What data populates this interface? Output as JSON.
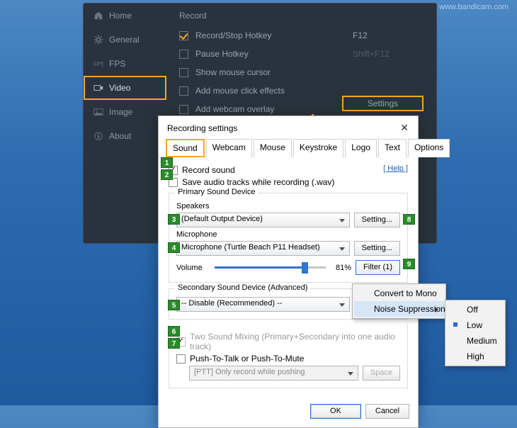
{
  "watermark": "www.bandicam.com",
  "main": {
    "sidebar": [
      {
        "label": "Home",
        "icon": "home-icon"
      },
      {
        "label": "General",
        "icon": "gear-icon"
      },
      {
        "label": "FPS",
        "icon": "fps-icon"
      },
      {
        "label": "Video",
        "icon": "video-icon"
      },
      {
        "label": "Image",
        "icon": "image-icon"
      },
      {
        "label": "About",
        "icon": "info-icon"
      }
    ],
    "section_title": "Record",
    "options": [
      {
        "label": "Record/Stop Hotkey",
        "hotkey": "F12",
        "checked": true
      },
      {
        "label": "Pause Hotkey",
        "hotkey": "Shift+F12",
        "checked": false
      },
      {
        "label": "Show mouse cursor",
        "hotkey": "",
        "checked": false
      },
      {
        "label": "Add mouse click effects",
        "hotkey": "",
        "checked": false
      },
      {
        "label": "Add webcam overlay",
        "hotkey": "",
        "checked": false
      }
    ],
    "settings_btn": "Settings"
  },
  "dialog": {
    "title": "Recording settings",
    "tabs": [
      "Sound",
      "Webcam",
      "Mouse",
      "Keystroke",
      "Logo",
      "Text",
      "Options"
    ],
    "help_label": "[ Help ]",
    "record_sound": "Record sound",
    "save_wav": "Save audio tracks while recording (.wav)",
    "primary_title": "Primary Sound Device",
    "speakers_label": "Speakers",
    "speakers_value": "(Default Output Device)",
    "setting_btn": "Setting...",
    "mic_label": "Microphone",
    "mic_value": "Microphone (Turtle Beach P11 Headset)",
    "volume_label": "Volume",
    "volume_pct": "81%",
    "volume_value": 81,
    "filter_btn": "Filter (1)",
    "secondary_title": "Secondary Sound Device (Advanced)",
    "secondary_value": "-- Disable (Recommended) --",
    "mixing": "Two Sound Mixing (Primary+Secondary into one audio track)",
    "ptt": "Push-To-Talk or Push-To-Mute",
    "ptt_mode": "[PTT] Only record while pushing",
    "ptt_key": "Space",
    "ok": "OK",
    "cancel": "Cancel"
  },
  "filter_menu": [
    "Convert to Mono",
    "Noise Suppression"
  ],
  "noise_menu": [
    "Off",
    "Low",
    "Medium",
    "High"
  ],
  "noise_selected": "Low",
  "badges": {
    "1": "1",
    "2": "2",
    "3": "3",
    "4": "4",
    "5": "5",
    "6": "6",
    "7": "7",
    "8": "8",
    "9": "9"
  }
}
